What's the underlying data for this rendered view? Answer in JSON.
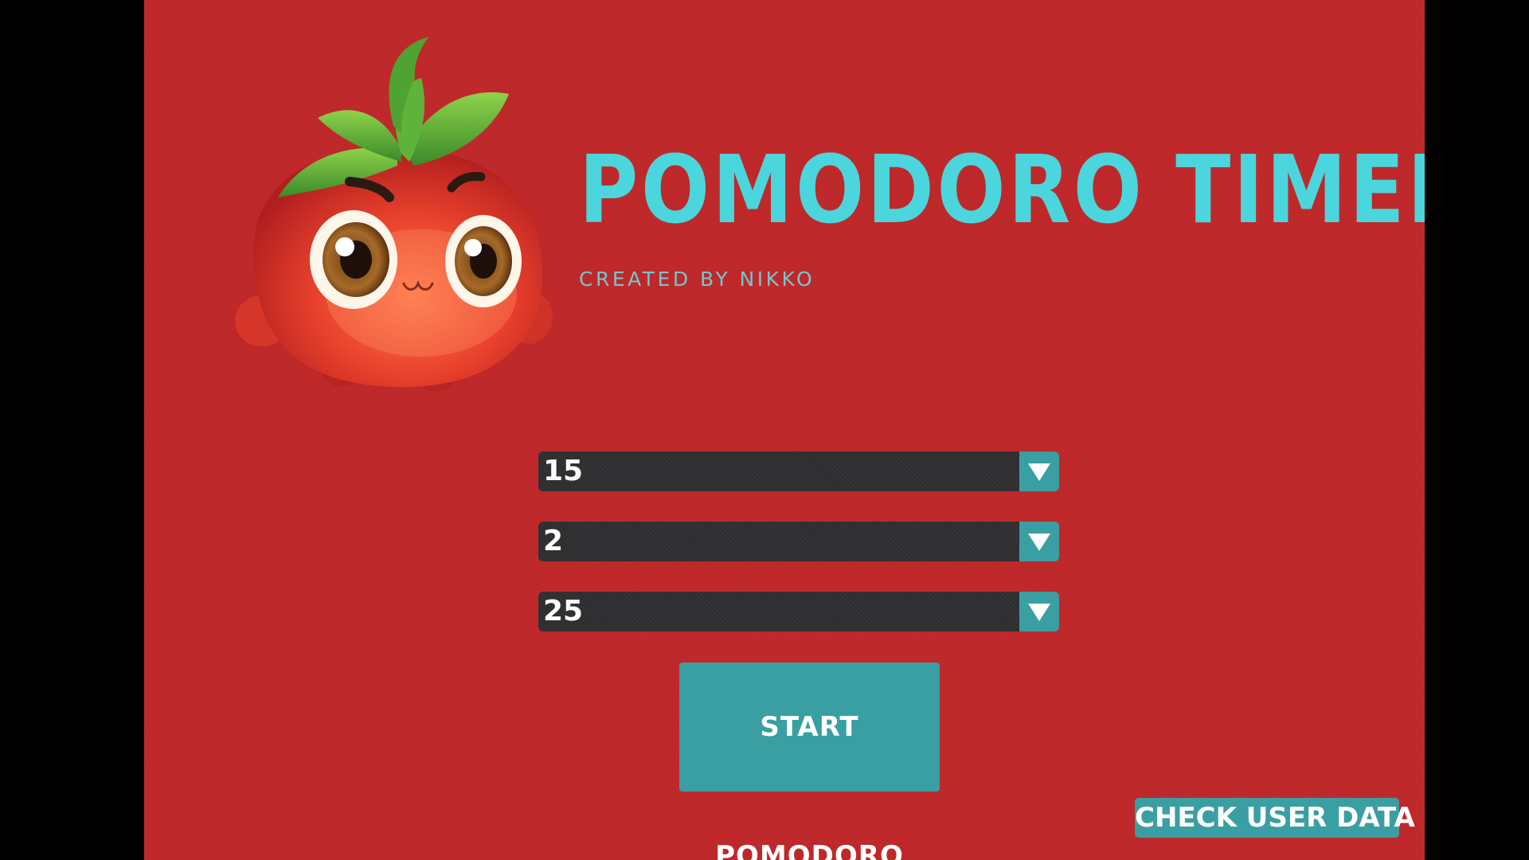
{
  "header": {
    "title": "POMODORO TIMER",
    "subtitle": "CREATED BY NIKKO"
  },
  "mascot": {
    "icon": "tomato-mascot-icon"
  },
  "selects": [
    {
      "value": "15"
    },
    {
      "value": "2"
    },
    {
      "value": "25"
    }
  ],
  "buttons": {
    "start_label": "START POMODORO",
    "check_label": "CHECK USER DATA"
  },
  "colors": {
    "background": "#c2292b",
    "accent": "#4ad6dc",
    "button": "#3a9fa2",
    "select_background": "#2d2d2f"
  }
}
